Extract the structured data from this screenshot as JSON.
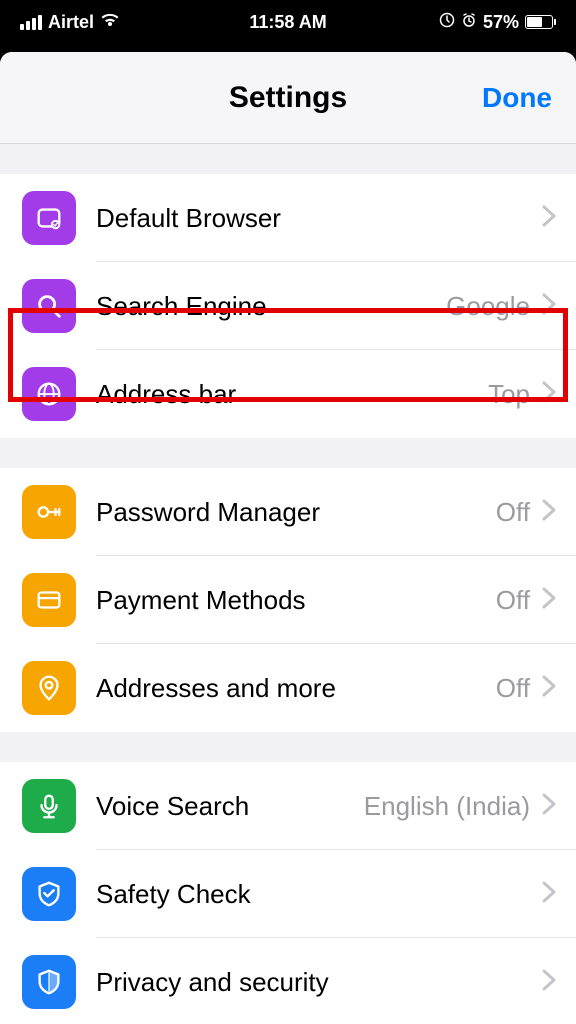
{
  "statusbar": {
    "carrier": "Airtel",
    "time": "11:58 AM",
    "battery_pct": "57%"
  },
  "header": {
    "title": "Settings",
    "done": "Done"
  },
  "groups": [
    {
      "rows": [
        {
          "icon": "browser-icon",
          "color": "purple",
          "label": "Default Browser",
          "value": ""
        },
        {
          "icon": "search-icon",
          "color": "purple",
          "label": "Search Engine",
          "value": "Google"
        },
        {
          "icon": "globe-icon",
          "color": "purple",
          "label": "Address bar",
          "value": "Top"
        }
      ]
    },
    {
      "rows": [
        {
          "icon": "key-icon",
          "color": "amber",
          "label": "Password Manager",
          "value": "Off"
        },
        {
          "icon": "card-icon",
          "color": "amber",
          "label": "Payment Methods",
          "value": "Off"
        },
        {
          "icon": "pin-icon",
          "color": "amber",
          "label": "Addresses and more",
          "value": "Off"
        }
      ]
    },
    {
      "rows": [
        {
          "icon": "mic-icon",
          "color": "green",
          "label": "Voice Search",
          "value": "English (India)"
        },
        {
          "icon": "shield-check-icon",
          "color": "blue",
          "label": "Safety Check",
          "value": ""
        },
        {
          "icon": "shield-icon",
          "color": "blue",
          "label": "Privacy and security",
          "value": ""
        }
      ]
    }
  ],
  "highlight_row_index": 2
}
